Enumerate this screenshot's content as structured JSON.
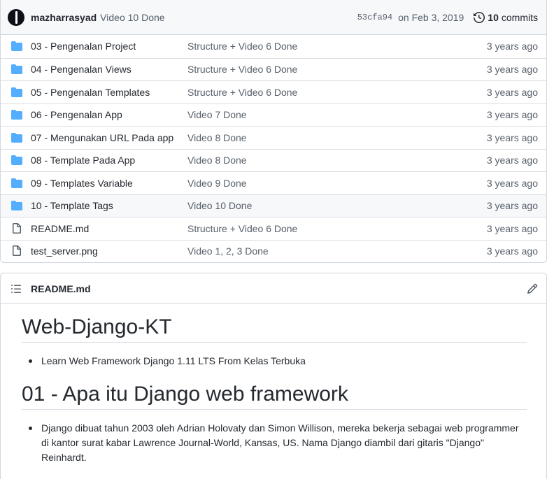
{
  "commit": {
    "author": "mazharrasyad",
    "message": "Video 10 Done",
    "sha": "53cfa94",
    "date": "on Feb 3, 2019",
    "count": "10",
    "count_label": "commits"
  },
  "files": [
    {
      "name": "03 - Pengenalan Project",
      "type": "folder",
      "message": "Structure + Video 6 Done",
      "age": "3 years ago"
    },
    {
      "name": "04 - Pengenalan Views",
      "type": "folder",
      "message": "Structure + Video 6 Done",
      "age": "3 years ago"
    },
    {
      "name": "05 - Pengenalan Templates",
      "type": "folder",
      "message": "Structure + Video 6 Done",
      "age": "3 years ago"
    },
    {
      "name": "06 - Pengenalan App",
      "type": "folder",
      "message": "Video 7 Done",
      "age": "3 years ago"
    },
    {
      "name": "07 - Mengunakan URL Pada app",
      "type": "folder",
      "message": "Video 8 Done",
      "age": "3 years ago"
    },
    {
      "name": "08 - Template Pada App",
      "type": "folder",
      "message": "Video 8 Done",
      "age": "3 years ago"
    },
    {
      "name": "09 - Templates Variable",
      "type": "folder",
      "message": "Video 9 Done",
      "age": "3 years ago"
    },
    {
      "name": "10 - Template Tags",
      "type": "folder",
      "message": "Video 10 Done",
      "age": "3 years ago"
    },
    {
      "name": "README.md",
      "type": "file",
      "message": "Structure + Video 6 Done",
      "age": "3 years ago"
    },
    {
      "name": "test_server.png",
      "type": "file",
      "message": "Video 1, 2, 3 Done",
      "age": "3 years ago"
    }
  ],
  "readme": {
    "filename": "README.md",
    "h1": "Web-Django-KT",
    "bullet1": "Learn Web Framework Django 1.11 LTS From Kelas Terbuka",
    "h2": "01 - Apa itu Django web framework",
    "bullet2": "Django dibuat tahun 2003 oleh Adrian Holovaty dan Simon Willison, mereka bekerja sebagai web programmer di kantor surat kabar Lawrence Journal-World, Kansas, US. Nama Django diambil dari gitaris \"Django\" Reinhardt."
  },
  "colors": {
    "folder": "#54aeff",
    "file_icon": "#57606a"
  },
  "icons": {
    "folder": "folder-icon",
    "file": "file-icon",
    "history": "history-icon",
    "list": "list-icon",
    "edit": "pencil-icon"
  }
}
